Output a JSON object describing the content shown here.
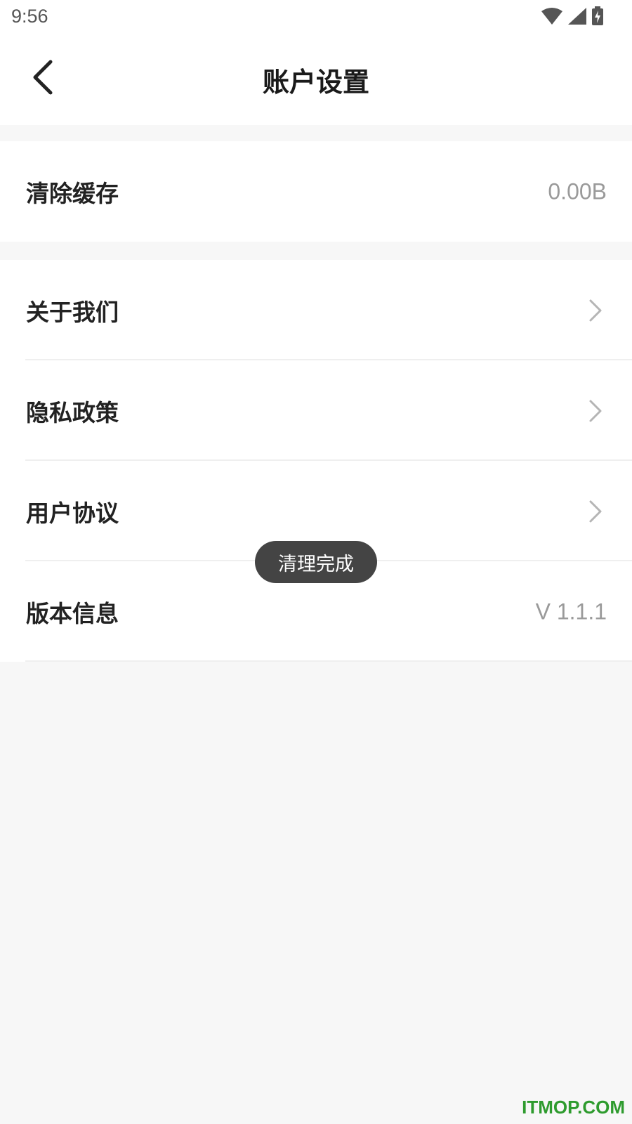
{
  "status_bar": {
    "time": "9:56",
    "icons": [
      "wifi-icon",
      "signal-icon",
      "battery-charging-icon"
    ]
  },
  "header": {
    "title": "账户设置",
    "back_icon": "chevron-left-icon"
  },
  "cache_section": {
    "label": "清除缓存",
    "value": "0.00B"
  },
  "menu": {
    "items": [
      {
        "label": "关于我们",
        "icon": "chevron-right-icon"
      },
      {
        "label": "隐私政策",
        "icon": "chevron-right-icon"
      },
      {
        "label": "用户协议",
        "icon": "chevron-right-icon"
      },
      {
        "label": "版本信息",
        "value": "V 1.1.1"
      }
    ]
  },
  "toast": {
    "text": "清理完成"
  },
  "watermark": {
    "text": "ITMOP.COM"
  },
  "colors": {
    "background": "#f7f7f7",
    "card": "#ffffff",
    "text_primary": "#222222",
    "text_secondary": "#9a9a9a",
    "toast_bg": "#444444",
    "watermark": "#2e9b2e"
  }
}
